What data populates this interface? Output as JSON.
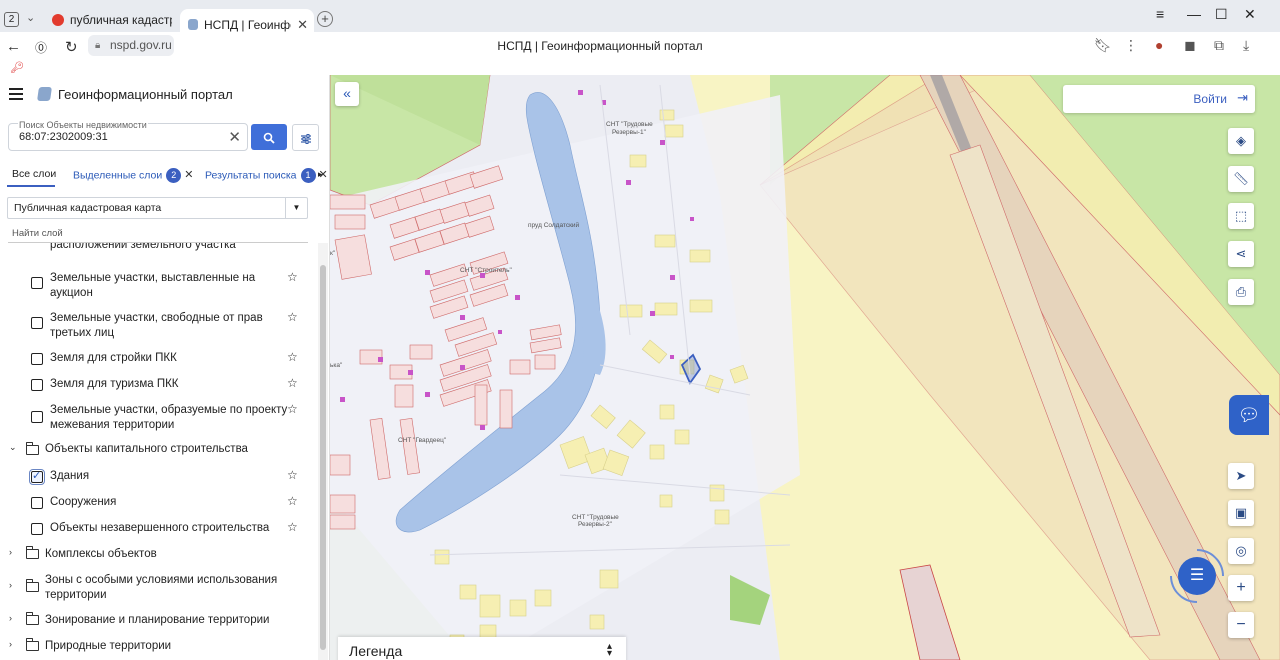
{
  "browser": {
    "tab_count": "2",
    "tabs": [
      {
        "title": "публичная кадастровая к",
        "active": false
      },
      {
        "title": "НСПД | Геоинформаци",
        "active": true
      }
    ],
    "url": "nspd.gov.ru",
    "page_title": "НСПД | Геоинформационный портал"
  },
  "app": {
    "title": "Геоинформационный портал"
  },
  "search": {
    "label": "Поиск Объекты недвижимости",
    "value": "68:07:2302009:31"
  },
  "layer_tabs": [
    {
      "label": "Все слои",
      "active": true
    },
    {
      "label": "Выделенные слои",
      "badge": "2"
    },
    {
      "label": "Результаты поиска",
      "badge": "1"
    }
  ],
  "map_select": {
    "value": "Публичная кадастровая карта"
  },
  "layer_search": {
    "placeholder": "Найти слой"
  },
  "tree": {
    "cut_item": "расположении земельного участка",
    "items": [
      {
        "label": "Земельные участки, выставленные на аукцион",
        "checked": false
      },
      {
        "label": "Земельные участки, свободные от прав третьих лиц",
        "checked": false
      },
      {
        "label": "Земля для стройки ПКК",
        "checked": false
      },
      {
        "label": "Земля для туризма ПКК",
        "checked": false
      },
      {
        "label": "Земельные участки, образуемые по проекту межевания территории",
        "checked": false
      }
    ],
    "group_open": "Объекты капитального строительства",
    "group_items": [
      {
        "label": "Здания",
        "checked": true
      },
      {
        "label": "Сооружения",
        "checked": false
      },
      {
        "label": "Объекты незавершенного строительства",
        "checked": false
      }
    ],
    "groups_closed": [
      "Комплексы объектов",
      "Зоны с особыми условиями использования территории",
      "Зонирование и планирование территории",
      "Природные территории"
    ]
  },
  "map": {
    "login_label": "Войти",
    "labels": {
      "snt_trudovye1": "СНТ \"Трудовые",
      "snt_trudovye1b": "Резервы-1\"",
      "snt_stroitel": "СНТ \"Строитель\"",
      "snt_gvardeets": "СНТ \"Гвардеец\"",
      "snt_trudovye2": "СНТ \"Трудовые",
      "snt_trudovye2b": "Резервы-2\"",
      "pond": "пруд Солдатский",
      "edge_k": "к\"",
      "edge_ka": "ька\""
    },
    "legend_label": "Легенда"
  },
  "colors": {
    "accent": "#2f62c8",
    "link": "#2b5ab8",
    "water": "#a9c3e8",
    "field_green": "#c8e6a6",
    "parcel_yellow": "#f6efb2",
    "road_pale": "#ecedf3"
  }
}
